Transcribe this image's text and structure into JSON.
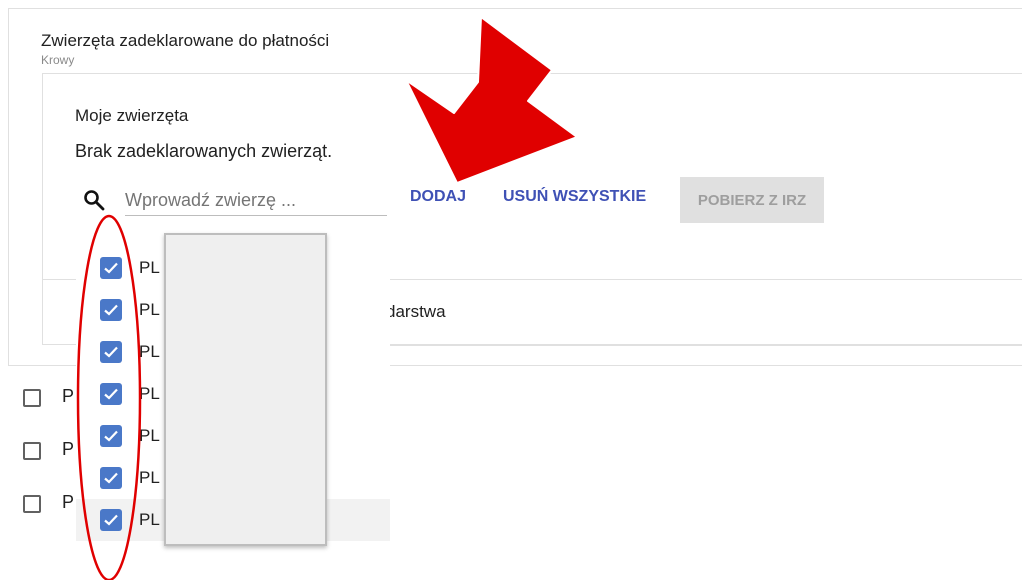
{
  "card": {
    "title": "Zwierzęta zadeklarowane do płatności",
    "subtitle": "Krowy"
  },
  "section": {
    "title": "Moje zwierzęta",
    "empty_message": "Brak zadeklarowanych zwierząt."
  },
  "search": {
    "placeholder": "Wprowadź zwierzę ...",
    "value": ""
  },
  "buttons": {
    "add": "DODAJ",
    "remove_all": "USUŃ WSZYSTKIE",
    "fetch_irz": "POBIERZ Z IRZ"
  },
  "background_text": {
    "partial_label": "darstwa"
  },
  "background_rows": [
    {
      "label": "P",
      "checked": false
    },
    {
      "label": "P",
      "checked": false
    },
    {
      "label": "P",
      "checked": false
    }
  ],
  "dropdown_items": [
    {
      "label": "PL",
      "checked": true
    },
    {
      "label": "PL",
      "checked": true
    },
    {
      "label": "PL",
      "checked": true
    },
    {
      "label": "PL",
      "checked": true
    },
    {
      "label": "PL",
      "checked": true
    },
    {
      "label": "PL",
      "checked": true
    },
    {
      "label": "PL",
      "checked": true
    }
  ],
  "colors": {
    "accent": "#3f51b5",
    "checkbox": "#4a78c8",
    "annotation": "#e00000"
  },
  "annotations": {
    "arrow": "red-arrow-icon",
    "circle": "red-ellipse"
  }
}
